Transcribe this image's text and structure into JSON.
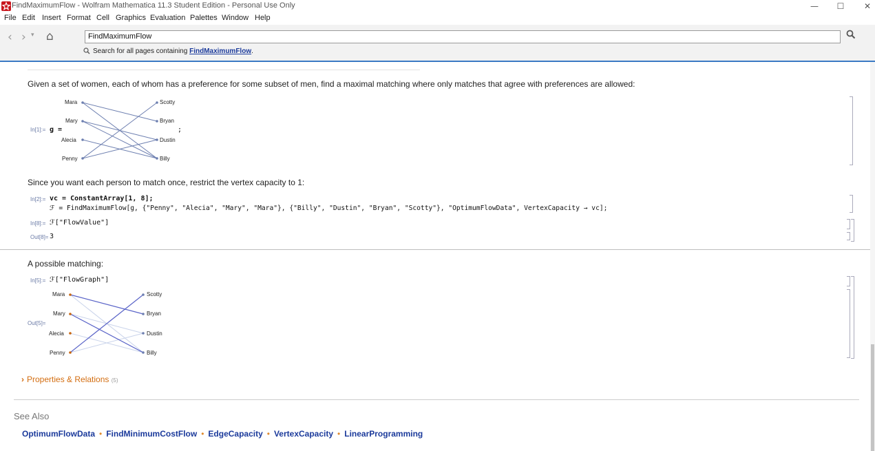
{
  "window": {
    "title": "FindMaximumFlow - Wolfram Mathematica 11.3 Student Edition - Personal Use Only",
    "minimize": "—",
    "maximize": "☐",
    "close": "✕"
  },
  "menu": [
    "File",
    "Edit",
    "Insert",
    "Format",
    "Cell",
    "Graphics",
    "Evaluation",
    "Palettes",
    "Window",
    "Help"
  ],
  "nav": {
    "back": "‹",
    "forward": "›",
    "history": "▾",
    "home": "⌂",
    "search_value": "FindMaximumFlow",
    "search_all_prefix": "Search for all pages containing ",
    "search_all_term": "FindMaximumFlow",
    "search_all_suffix": "."
  },
  "content": {
    "intro": "Given a set of women, each of whom has a preference for some subset of men, find a maximal matching where only matches that agree with preferences are allowed:",
    "in1_label": "In[1]:=",
    "in1_g": "g =",
    "in1_semicolon": ";",
    "graph1": {
      "left": [
        "Mara",
        "Mary",
        "Alecia",
        "Penny"
      ],
      "right": [
        "Scotty",
        "Bryan",
        "Dustin",
        "Billy"
      ]
    },
    "restrict_text": "Since you want each person to match once, restrict the vertex capacity to 1:",
    "in2_label": "In[2]:=",
    "in2_line1": "vc = ConstantArray[1, 8];",
    "in2_line2": "ℱ = FindMaximumFlow[g, {\"Penny\", \"Alecia\", \"Mary\", \"Mara\"}, {\"Billy\", \"Dustin\", \"Bryan\", \"Scotty\"}, \"OptimumFlowData\", VertexCapacity → vc];",
    "in8_label": "In[8]:=",
    "in8_code": "ℱ[\"FlowValue\"]",
    "out8_label": "Out[8]=",
    "out8_value": "3",
    "matching_text": "A possible matching:",
    "in5_label": "In[5]:=",
    "in5_code": "ℱ[\"FlowGraph\"]",
    "out5_label": "Out[5]=",
    "graph2": {
      "left": [
        "Mara",
        "Mary",
        "Alecia",
        "Penny"
      ],
      "right": [
        "Scotty",
        "Bryan",
        "Dustin",
        "Billy"
      ]
    },
    "properties_link": "Properties & Relations",
    "properties_count": "(5)",
    "see_also_title": "See Also",
    "see_also": [
      "OptimumFlowData",
      "FindMinimumCostFlow",
      "EdgeCapacity",
      "VertexCapacity",
      "LinearProgramming"
    ],
    "see_also_sep": "•"
  },
  "colors": {
    "edge": "#6d7fb0",
    "flow_edge": "#5a64c8",
    "faint_edge": "#c9d3ea",
    "source_vertex": "#c8650f",
    "link": "#1b3a9b",
    "accent": "#d36d10"
  }
}
